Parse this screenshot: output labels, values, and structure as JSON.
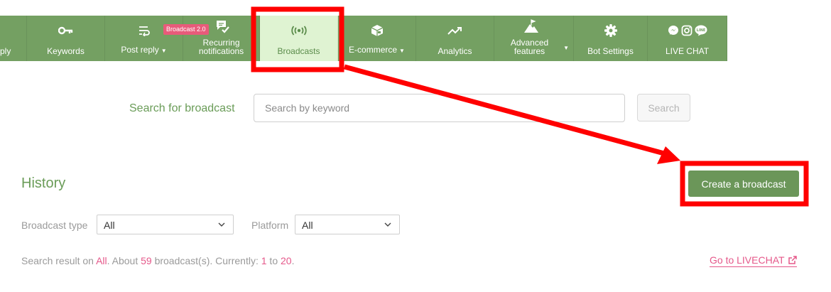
{
  "nav": {
    "items": [
      {
        "label": "ply",
        "icon": "reply-icon"
      },
      {
        "label": "Keywords",
        "icon": "key-icon"
      },
      {
        "label": "Post reply",
        "icon": "post-reply-icon",
        "dropdown": true
      },
      {
        "label": "Recurring notifications",
        "label_line1": "Recurring",
        "label_line2": "notifications",
        "icon": "chat-check-icon"
      },
      {
        "label": "Broadcasts",
        "icon": "broadcast-icon",
        "active": true
      },
      {
        "label": "E-commerce",
        "icon": "box-icon",
        "dropdown": true
      },
      {
        "label": "Analytics",
        "icon": "trend-icon"
      },
      {
        "label": "Advanced features",
        "label_line1": "Advanced",
        "label_line2": "features",
        "icon": "mountain-flag-icon",
        "dropdown": true
      },
      {
        "label": "Bot Settings",
        "icon": "gear-icon"
      },
      {
        "label": "LIVE CHAT",
        "icon": "messenger-instagram-line-icons"
      }
    ],
    "badge": "Broadcast 2.0"
  },
  "search": {
    "label": "Search for broadcast",
    "placeholder": "Search by keyword",
    "value": "",
    "button": "Search"
  },
  "history": {
    "title": "History",
    "create_button": "Create a broadcast",
    "filters": {
      "broadcast_type_label": "Broadcast type",
      "broadcast_type_value": "All",
      "platform_label": "Platform",
      "platform_value": "All"
    },
    "result": {
      "prefix": "Search result on ",
      "scope": "All",
      "mid1": ". About ",
      "count": "59",
      "mid2": " broadcast(s). Currently: ",
      "from": "1",
      "to_word": " to ",
      "to": "20",
      "suffix": "."
    },
    "livechat_link": "Go to LIVECHAT"
  },
  "colors": {
    "nav_green": "#74a062",
    "active_tab_bg": "#dff3d2",
    "accent_pink": "#e5588a",
    "annotation_red": "#ff0000"
  }
}
